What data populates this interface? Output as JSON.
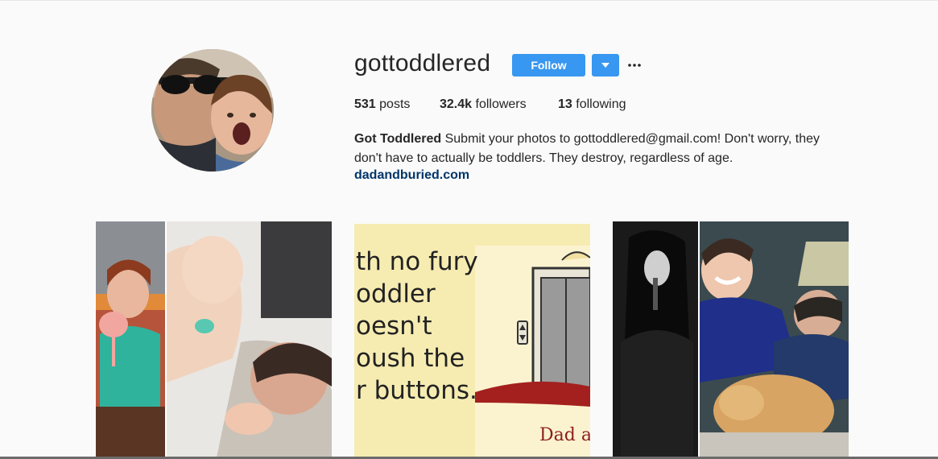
{
  "profile": {
    "username": "gottoddlered",
    "follow_label": "Follow",
    "stats": {
      "posts_count": "531",
      "posts_label": "posts",
      "followers_count": "32.4k",
      "followers_label": "followers",
      "following_count": "13",
      "following_label": "following"
    },
    "bio": {
      "name": "Got Toddlered",
      "text": "Submit your photos to gottoddlered@gmail.com! Don't worry, they don't have to actually be toddlers. They destroy, regardless of age.",
      "link": "dadandburied.com"
    }
  },
  "posts": [
    {
      "kind": "photo-collage"
    },
    {
      "kind": "comic",
      "lines": [
        "th no fury",
        "oddler",
        "oesn't",
        "oush the",
        "r buttons."
      ],
      "signature": "Dad and"
    },
    {
      "kind": "photo-collage"
    }
  ],
  "colors": {
    "accent": "#3897f0",
    "link": "#003569",
    "background": "#fafafa"
  },
  "icons": {
    "dropdown": "caret-down-icon",
    "more": "more-options-icon"
  }
}
